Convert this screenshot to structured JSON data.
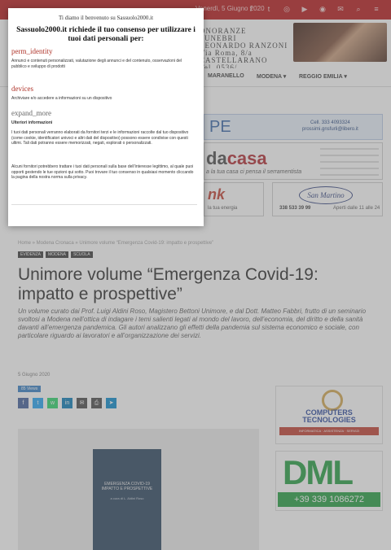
{
  "topbar": {
    "date": "Venerdì, 5 Giugno 2020",
    "icons": [
      "facebook-icon",
      "twitter-icon",
      "instagram-icon",
      "youtube-icon",
      "rss-icon",
      "email-icon",
      "search-icon",
      "menu-icon"
    ],
    "icon_glyphs": [
      "f",
      "t",
      "◎",
      "▶",
      "◉",
      "✉",
      "⌕",
      "≡"
    ]
  },
  "header": {
    "ad_lines": [
      "ONORANZE",
      "FUNEBRI",
      "LEONARDO RANZONI",
      "Via Roma, 8/a",
      "CASTELLARANO",
      "Tel. 0536/....."
    ]
  },
  "nav": {
    "items": [
      "MARANELLO",
      "MODENA ▾",
      "REGGIO EMILIA ▾"
    ]
  },
  "ads": {
    "ad1_big": "PE",
    "ad1_tel": "Cell. 333 4093324",
    "ad1_web": "prossimi.gnsfurli@libero.it",
    "ad2_brand": "da",
    "ad2_brand2": "casa",
    "ad2_sub": "a la tua casa ci pensa il serramentista",
    "ad3_logo": "nk",
    "ad3_small": "la tua energia",
    "ad4_logo": "San Martino",
    "ad4_tel": "338 533 39 99",
    "ad4_hours": "Aperti dalle 11 alle 24"
  },
  "article": {
    "breadcrumb": "Home » Modena Cronaca » Unimore volume “Emergenza Covid-19: impatto e prospettive”",
    "tags": [
      "EVIDENZA",
      "MODENA",
      "SCUOLA"
    ],
    "title": "Unimore volume “Emergenza Covid-19: impatto e prospettive”",
    "lead": "Un volume curato dai Prof. Luigi Aldini Roso, Magistero Bettoni Unimore, e dal Dott. Matteo Fabbri, frutto di un seminario svoltosi a Modena nell’ottica di indagare i temi salienti legati al mondo del lavoro, dell’economia, del diritto e della sanità davanti all’emergenza pandemica. Gli autori analizzano gli effetti della pandemia sul sistema economico e sociale, con particolare riguardo ai lavoratori e all’organizzazione dei servizi.",
    "date": "5 Giugno 2020",
    "views_label": "85 Views",
    "share_buttons": [
      {
        "name": "facebook",
        "glyph": "f",
        "color": "#3b5998"
      },
      {
        "name": "twitter",
        "glyph": "t",
        "color": "#1da1f2"
      },
      {
        "name": "whatsapp",
        "glyph": "w",
        "color": "#25d366"
      },
      {
        "name": "linkedin",
        "glyph": "in",
        "color": "#0077b5"
      },
      {
        "name": "email",
        "glyph": "✉",
        "color": "#444444"
      },
      {
        "name": "print",
        "glyph": "⎙",
        "color": "#444444"
      },
      {
        "name": "telegram",
        "glyph": "➤",
        "color": "#0088cc"
      }
    ],
    "book_title": "EMERGENZA COVID-19 IMPATTO E PROSPETTIVE",
    "book_subtitle": "a cura di L. Aldini Roso"
  },
  "sidebar": {
    "computers_title": "COMPUTERS TECNOLOGIES",
    "computers_bar": "INFORMATICA · ASSISTENZA · SERVIZI",
    "dml_logo": "DML",
    "dml_phone": "+39 339 1086272"
  },
  "consent": {
    "welcome": "Ti diamo il benvenuto su Sassuolo2000.it",
    "title": "Sassuolo2000.it richiede il tuo consenso per utilizzare i tuoi dati personali per:",
    "sections": [
      {
        "heading": "perm_identity",
        "text": "Annunci e contenuti personalizzati, valutazione degli annunci e del contenuto, osservazioni del pubblico e sviluppo di prodotti"
      },
      {
        "heading": "devices",
        "text": "Archiviare e/o accedere a informazioni su un dispositivo"
      },
      {
        "heading": "expand_more",
        "text": "Ulteriori informazioni"
      }
    ],
    "body_1": "I tuoi dati personali verranno elaborati da fornitori terzi e le informazioni raccolte dal tuo dispositivo (come cookie, identificatori univoci e altri dati del dispositivo) possono essere condivise con questi ultimi. Tali dati potranno essere memorizzati, negati, esplorati o personalizzati.",
    "body_2": "Alcuni fornitori potrebbero trattare i tuoi dati personali sulla base dell’interesse legittimo, al quale puoi opporti gestendo le tue opzioni qui sotto. Puoi trovare il tuo consenso in qualsiasi momento cliccando la pagina della nostra norma sulla privacy."
  }
}
